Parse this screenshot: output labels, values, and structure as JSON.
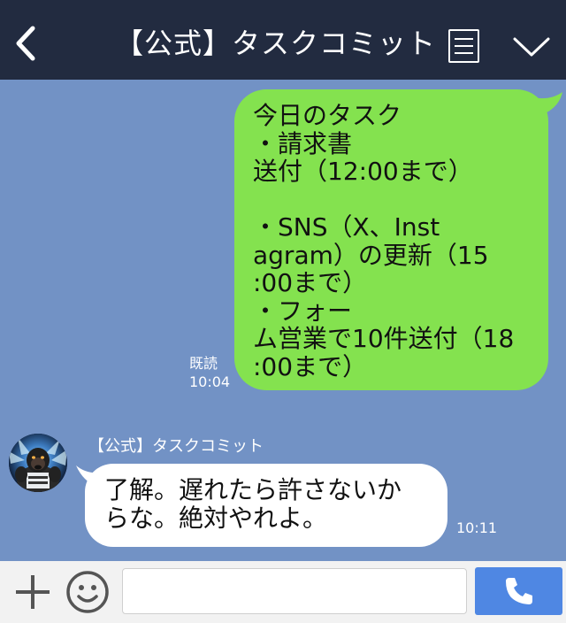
{
  "header": {
    "title": "【公式】タスクコミット",
    "back_icon": "chevron-left-icon",
    "menu_icon": "menu-icon",
    "collapse_icon": "chevron-down-icon",
    "background": "#222b40"
  },
  "chat": {
    "background": "#7292c5",
    "messages": [
      {
        "direction": "outgoing",
        "bubble_color": "#84e24f",
        "lines": [
          "今日のタスク",
          "・請求書",
          "送付（12:00まで）",
          "",
          "・SNS（X、Inst",
          "agram）の更新（15",
          ":00まで）",
          "・フォー",
          "ム営業で10件送付（18",
          ":00まで）"
        ],
        "read_label": "既読",
        "time": "10:04"
      },
      {
        "direction": "incoming",
        "sender": "【公式】タスクコミット",
        "bubble_color": "#ffffff",
        "lines": [
          "了解。遅れたら許さないか",
          "らな。絶対やれよ。"
        ],
        "time": "10:11"
      }
    ]
  },
  "input_bar": {
    "plus_icon": "plus-icon",
    "emoji_icon": "smiley-icon",
    "message_value": "",
    "placeholder": "",
    "call_icon": "phone-icon",
    "call_button_color": "#4f87e3"
  }
}
